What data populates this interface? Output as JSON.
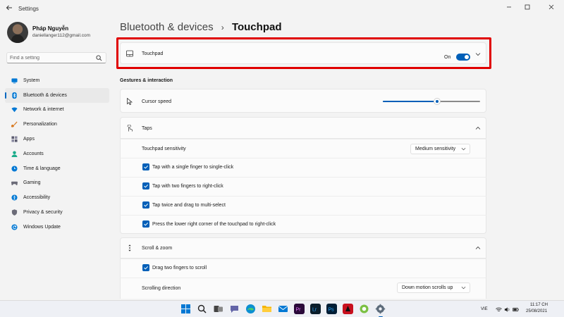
{
  "window": {
    "title": "Settings",
    "back_icon": "back-arrow-icon",
    "controls": [
      "minimize-icon",
      "maximize-icon",
      "close-icon"
    ]
  },
  "user": {
    "name": "Pháp Nguyễn",
    "email": "daniellanger112@gmail.com"
  },
  "search": {
    "placeholder": "Find a setting",
    "icon": "search-icon"
  },
  "nav": {
    "items": [
      {
        "label": "System",
        "icon": "system-icon",
        "color": "#0078d4"
      },
      {
        "label": "Bluetooth & devices",
        "icon": "bluetooth-icon",
        "color": "#0078d4",
        "active": true
      },
      {
        "label": "Network & internet",
        "icon": "wifi-icon",
        "color": "#0078d4"
      },
      {
        "label": "Personalization",
        "icon": "brush-icon",
        "color": "#d87b24"
      },
      {
        "label": "Apps",
        "icon": "apps-icon",
        "color": "#5a5a6e"
      },
      {
        "label": "Accounts",
        "icon": "accounts-icon",
        "color": "#1aab8a"
      },
      {
        "label": "Time & language",
        "icon": "globe-clock-icon",
        "color": "#0078d4"
      },
      {
        "label": "Gaming",
        "icon": "gamepad-icon",
        "color": "#6b6b78"
      },
      {
        "label": "Accessibility",
        "icon": "accessibility-icon",
        "color": "#0078d4"
      },
      {
        "label": "Privacy & security",
        "icon": "shield-icon",
        "color": "#6b6b78"
      },
      {
        "label": "Windows Update",
        "icon": "update-icon",
        "color": "#0078d4"
      }
    ]
  },
  "breadcrumb": {
    "parent": "Bluetooth & devices",
    "separator": "›",
    "current": "Touchpad"
  },
  "touchpad_card": {
    "label": "Touchpad",
    "state": "On",
    "enabled": true,
    "icon": "touchpad-icon",
    "highlight_color": "#e00000"
  },
  "gestures": {
    "section_title": "Gestures & interaction",
    "cursor_speed": {
      "label": "Cursor speed",
      "icon": "cursor-icon",
      "value": 0.56
    },
    "taps": {
      "label": "Taps",
      "icon": "tap-icon",
      "expanded": true,
      "sensitivity_label": "Touchpad sensitivity",
      "sensitivity_value": "Medium sensitivity",
      "options": [
        {
          "label": "Tap with a single finger to single-click",
          "checked": true
        },
        {
          "label": "Tap with two fingers to right-click",
          "checked": true
        },
        {
          "label": "Tap twice and drag to multi-select",
          "checked": true
        },
        {
          "label": "Press the lower right corner of the touchpad to right-click",
          "checked": true
        }
      ]
    },
    "scroll_zoom": {
      "label": "Scroll & zoom",
      "icon": "scroll-icon",
      "expanded": true,
      "drag_scroll_label": "Drag two fingers to scroll",
      "direction_label": "Scrolling direction",
      "direction_value": "Down motion scrolls up"
    }
  },
  "taskbar": {
    "apps": [
      "windows-start-icon",
      "search-icon",
      "task-view-icon",
      "chat-icon",
      "edge-icon",
      "file-explorer-icon",
      "mail-icon",
      "premiere-icon",
      "lightroom-icon",
      "photoshop-icon",
      "app-red-icon",
      "app-green-icon",
      "settings-gear-icon"
    ],
    "language": "VIE",
    "time": "11:17 CH",
    "date": "25/08/2021",
    "accent": "#005fb8"
  }
}
